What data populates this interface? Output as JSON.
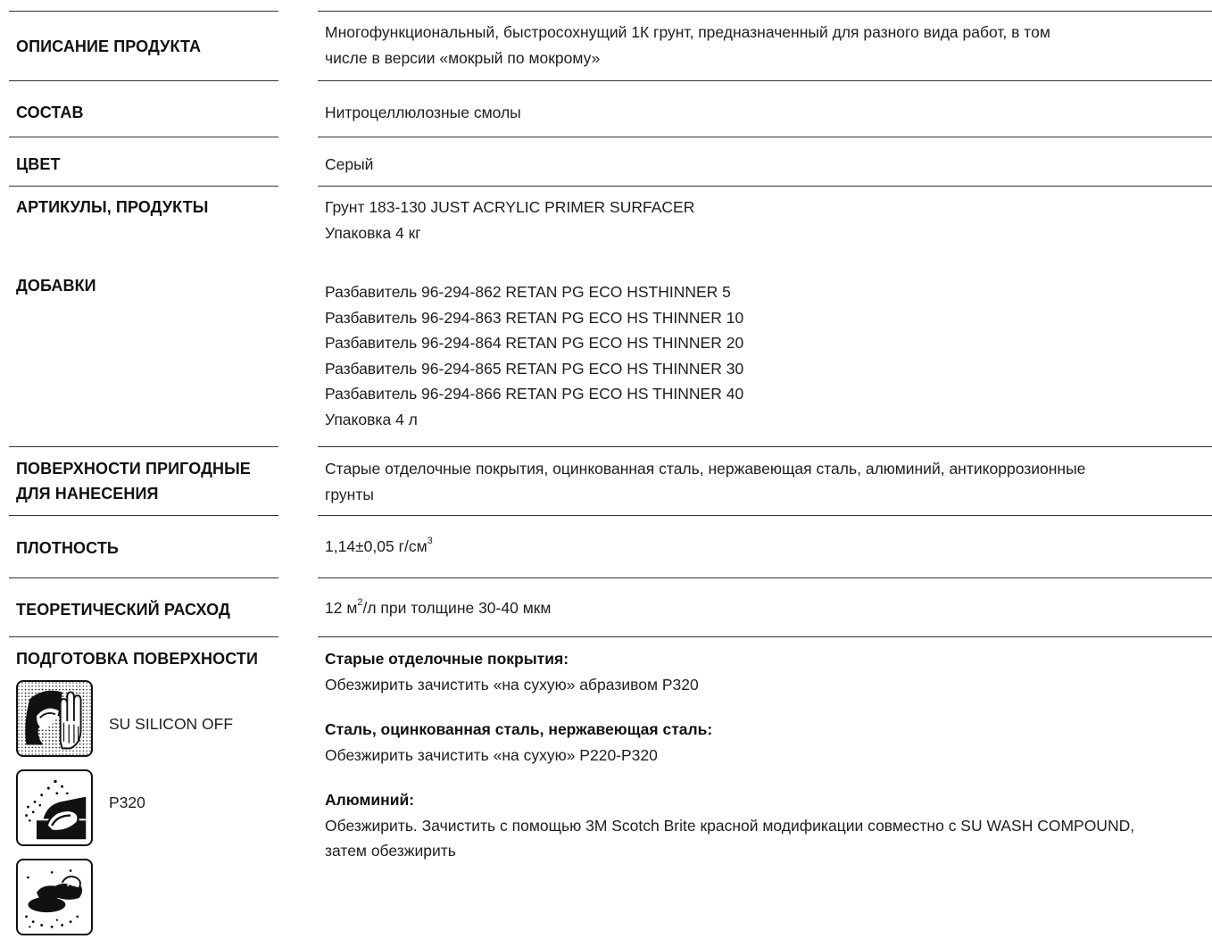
{
  "rows": {
    "description": {
      "label": "ОПИСАНИЕ ПРОДУКТА",
      "lines": [
        "Многофункциональный, быстросохнущий 1К грунт, предназначенный для разного вида работ, в том",
        "числе в версии «мокрый по мокрому»"
      ]
    },
    "composition": {
      "label": "СОСТАВ",
      "lines": [
        "Нитроцеллюлозные смолы"
      ]
    },
    "color": {
      "label": "ЦВЕТ",
      "lines": [
        "Серый"
      ]
    },
    "articles": {
      "label": "АРТИКУЛЫ, ПРОДУКТЫ",
      "lines": [
        "Грунт 183-130 JUST ACRYLIC PRIMER SURFACER",
        "Упаковка 4 кг"
      ]
    },
    "additives": {
      "label": "ДОБАВКИ",
      "lines": [
        "Разбавитель 96-294-862 RETAN PG ECO HSTHINNER 5",
        "Разбавитель 96-294-863 RETAN PG ECO HS THINNER 10",
        "Разбавитель 96-294-864 RETAN PG ECO HS THINNER 20",
        "Разбавитель 96-294-865 RETAN PG ECO HS THINNER 30",
        "Разбавитель 96-294-866 RETAN PG ECO HS THINNER 40",
        "Упаковка 4 л"
      ]
    },
    "surfaces": {
      "label_lines": [
        "ПОВЕРХНОСТИ ПРИГОДНЫЕ",
        "ДЛЯ НАНЕСЕНИЯ"
      ],
      "lines": [
        "Старые отделочные покрытия, оцинкованная сталь, нержавеющая сталь, алюминий, антикоррозионные",
        "грунты"
      ]
    },
    "density": {
      "label": "ПЛОТНОСТЬ",
      "value": "1,14±0,05 г/см",
      "sup": "3"
    },
    "consumption": {
      "label": "ТЕОРЕТИЧЕСКИЙ РАСХОД",
      "pre": "12 м",
      "sup": "2",
      "post": "/л при толщине 30-40 мкм"
    },
    "preparation": {
      "label": "ПОДГОТОВКА ПОВЕРХНОСТИ",
      "icons": [
        {
          "icon": "degrease-hand-icon",
          "caption": "SU SILICON OFF"
        },
        {
          "icon": "hand-sanding-icon",
          "caption": "P320"
        },
        {
          "icon": "machine-sanding-icon",
          "caption": ""
        }
      ],
      "sections": [
        {
          "heading": "Старые отделочные покрытия:",
          "lines": [
            "Обезжирить зачистить «на сухую» абразивом Р320"
          ]
        },
        {
          "heading": "Сталь, оцинкованная сталь, нержавеющая сталь:",
          "lines": [
            "Обезжирить зачистить «на сухую» Р220-Р320"
          ]
        },
        {
          "heading": "Алюминий:",
          "lines": [
            "Обезжирить. Зачистить с помощью 3М Scotch Brite красной модификации совместно с SU WASH COMPOUND,",
            "затем обезжирить"
          ]
        }
      ]
    }
  }
}
